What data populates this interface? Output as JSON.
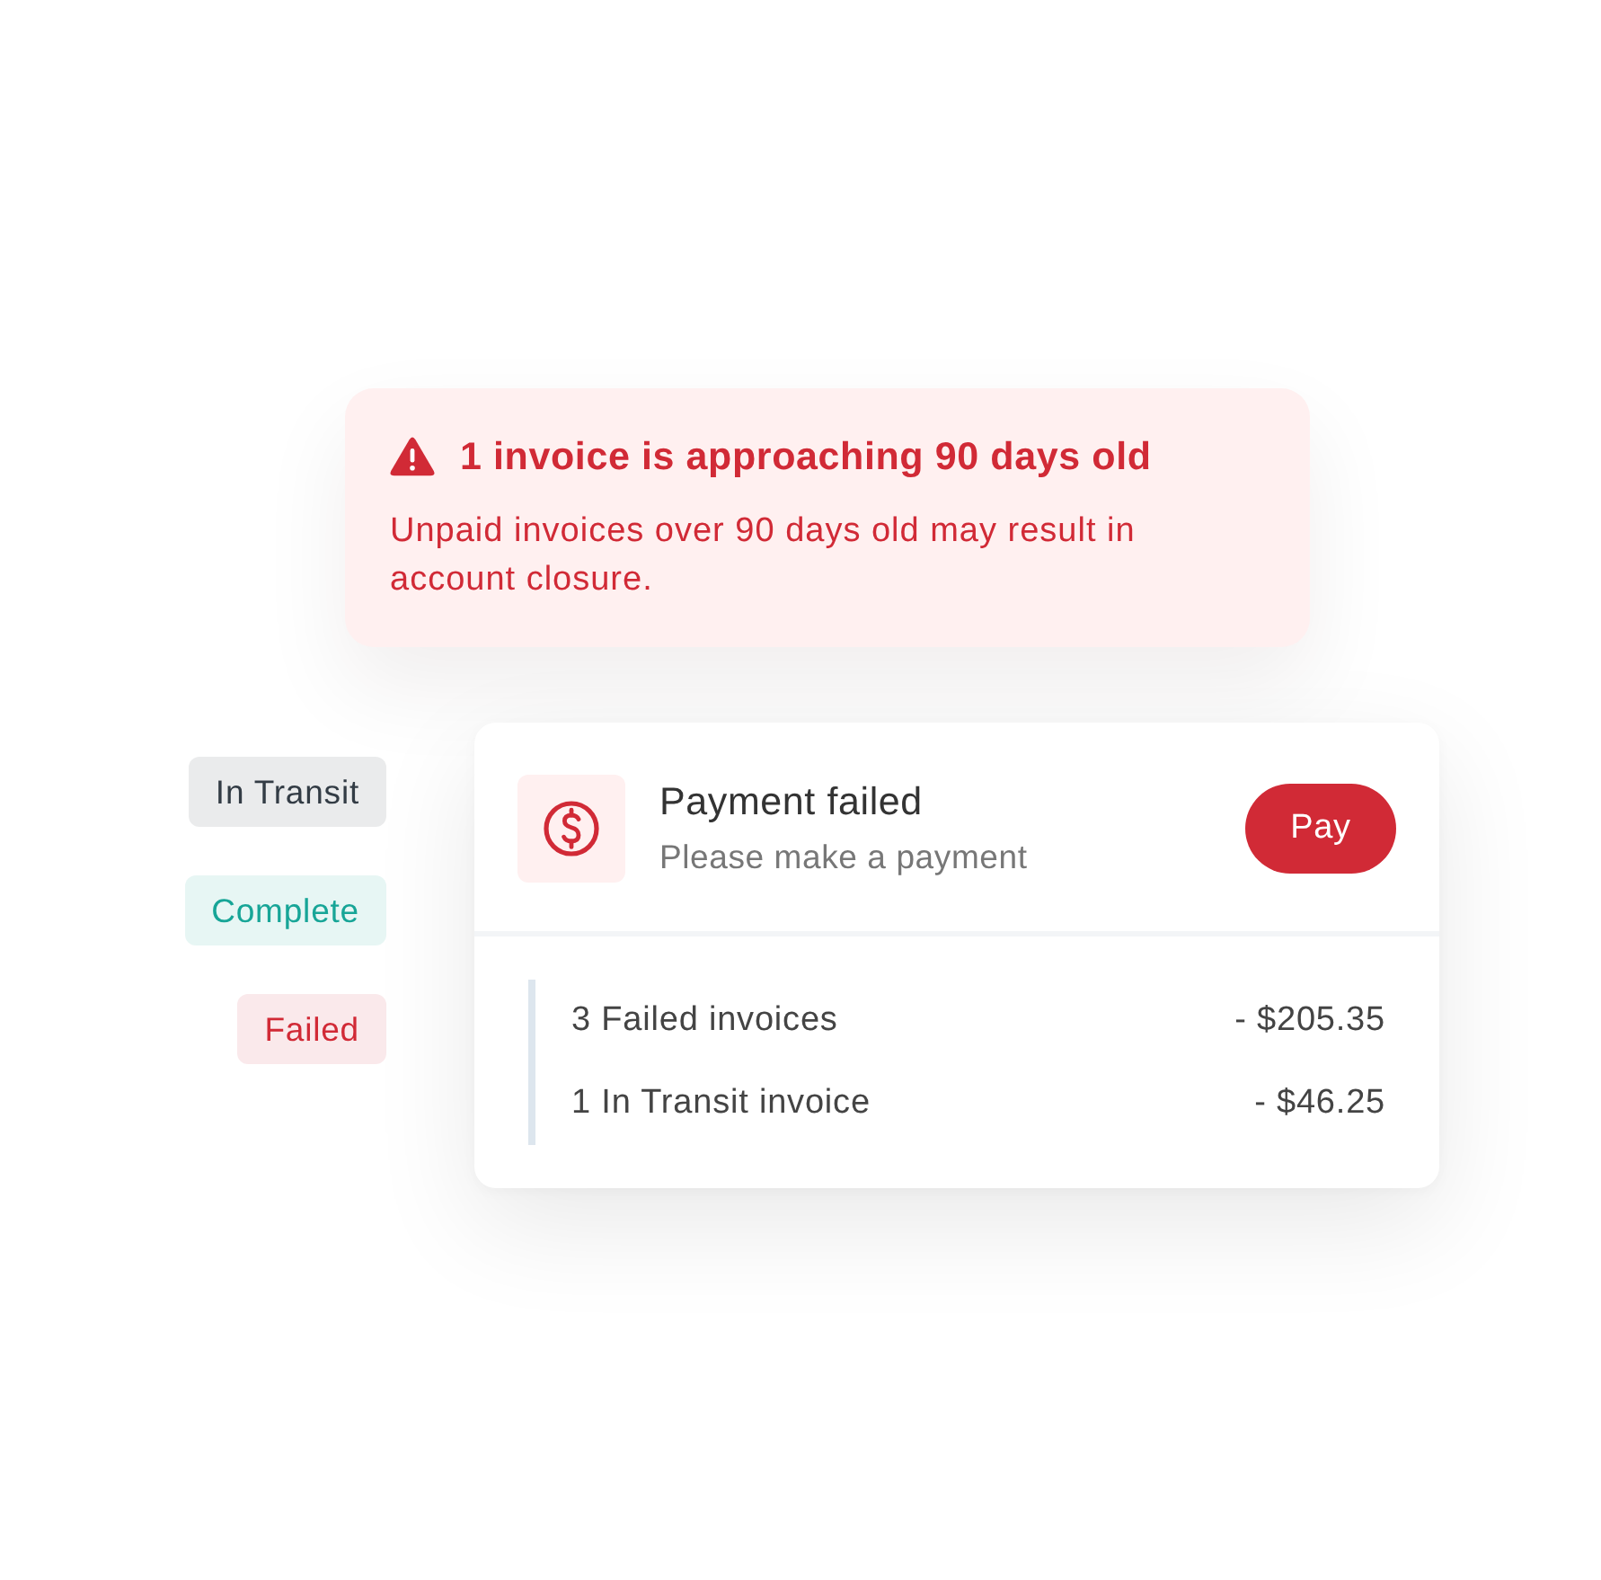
{
  "alert": {
    "title": "1 invoice is approaching 90 days old",
    "message": "Unpaid invoices over 90 days old may result in account closure."
  },
  "status_badges": [
    {
      "label": "In Transit",
      "color": "#333c45"
    },
    {
      "label": "Complete",
      "color": "#17a597"
    },
    {
      "label": "Failed",
      "color": "#d12a36"
    }
  ],
  "payment_card": {
    "title": "Payment failed",
    "subtitle": "Please make a payment",
    "button": "Pay",
    "rows": [
      {
        "label": "3 Failed invoices",
        "amount": "- $205.35"
      },
      {
        "label": "1 In Transit invoice",
        "amount": "- $46.25"
      }
    ]
  }
}
